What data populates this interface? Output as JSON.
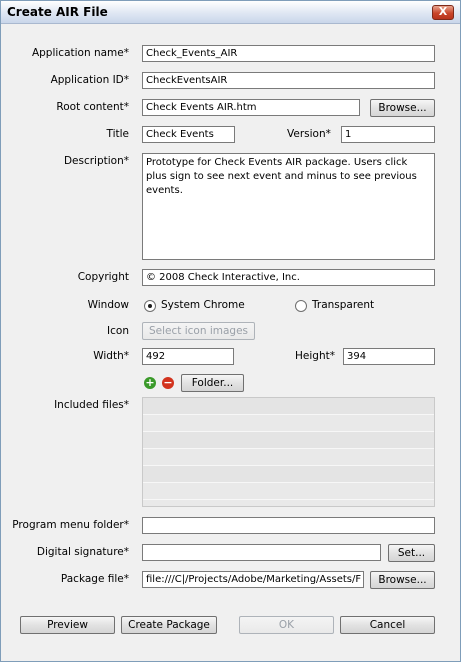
{
  "window": {
    "title": "Create AIR File",
    "close_glyph": "X"
  },
  "form": {
    "app_name": {
      "label": "Application name*",
      "value": "Check_Events_AIR"
    },
    "app_id": {
      "label": "Application ID*",
      "value": "CheckEventsAIR"
    },
    "root_content": {
      "label": "Root content*",
      "value": "Check Events AIR.htm",
      "browse": "Browse..."
    },
    "title": {
      "label": "Title",
      "value": "Check Events"
    },
    "version": {
      "label": "Version*",
      "value": "1"
    },
    "description": {
      "label": "Description*",
      "value": "Prototype for Check Events AIR package. Users click plus sign to see next event and minus to see previous events."
    },
    "copyright": {
      "label": "Copyright",
      "value": "© 2008 Check Interactive, Inc."
    },
    "window_opt": {
      "label": "Window",
      "option_system": "System Chrome",
      "option_transparent": "Transparent",
      "selected": "System Chrome"
    },
    "icon": {
      "label": "Icon",
      "button": "Select icon images"
    },
    "width": {
      "label": "Width*",
      "value": "492"
    },
    "height": {
      "label": "Height*",
      "value": "394"
    },
    "files": {
      "label": "Included files*",
      "folder_button": "Folder...",
      "add_icon": "plus-icon",
      "remove_icon": "minus-icon"
    },
    "program_menu": {
      "label": "Program menu folder*",
      "value": ""
    },
    "signature": {
      "label": "Digital signature*",
      "value": "",
      "button": "Set..."
    },
    "package_file": {
      "label": "Package file*",
      "value": "file:///C|/Projects/Adobe/Marketing/Assets/F",
      "browse": "Browse..."
    }
  },
  "buttons": {
    "preview": "Preview",
    "create": "Create Package",
    "ok": "OK",
    "cancel": "Cancel"
  },
  "colors": {
    "add": "#3a9a2a",
    "remove": "#d2331e",
    "close": "#c9452a"
  }
}
